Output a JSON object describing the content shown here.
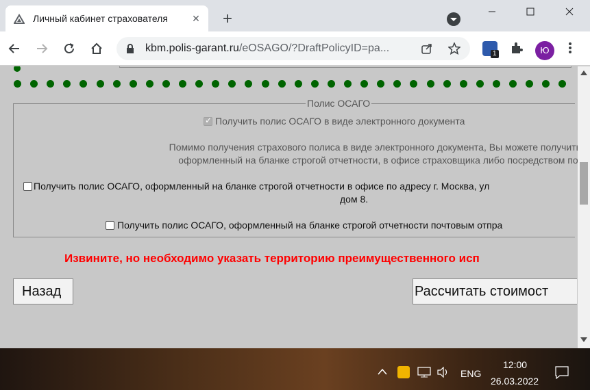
{
  "browser": {
    "tab_title": "Личный кабинет страхователя",
    "url_host": "kbm.polis-garant.ru",
    "url_path": "/eOSAGO/?DraftPolicyID=pa...",
    "extension_badge": "1",
    "profile_initial": "Ю"
  },
  "form": {
    "legend": "Полис ОСАГО",
    "electronic_label": "Получить полис ОСАГО в виде электронного документа",
    "electronic_checked": true,
    "info_line1": "Помимо получения страхового полиса в виде электронного документа, Вы можете получить данны",
    "info_line2": "оформленный на бланке строгой отчетности, в офисе страховщика либо посредством почтово",
    "office_label_line1": "Получить полис ОСАГО, оформленный на бланке строгой отчетности в офисе по адресу г. Москва, ул",
    "office_label_line2": "дом 8.",
    "post_label": "Получить полис ОСАГО, оформленный на бланке строгой отчетности почтовым отпра",
    "error_text": "Извините, но необходимо указать территорию преимущественного исп",
    "back_button": "Назад",
    "calc_button": "Рассчитать стоимост"
  },
  "taskbar": {
    "language": "ENG",
    "time": "12:00",
    "date": "26.03.2022"
  },
  "colors": {
    "dot_green": "#006400",
    "error_red": "#ff0000",
    "page_bg": "#c8c8c8"
  }
}
